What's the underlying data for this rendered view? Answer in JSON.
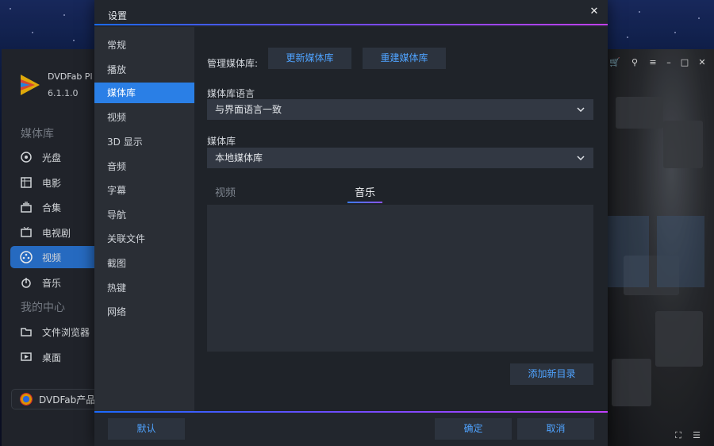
{
  "app": {
    "name": "DVDFab Pl",
    "version": "6.1.1.0",
    "section_media_library": "媒体库",
    "section_my_center": "我的中心",
    "sidebar_items": [
      {
        "label": "光盘",
        "icon": "disc-icon"
      },
      {
        "label": "电影",
        "icon": "film-icon"
      },
      {
        "label": "合集",
        "icon": "collection-icon"
      },
      {
        "label": "电视剧",
        "icon": "tv-icon"
      },
      {
        "label": "视频",
        "icon": "video-icon",
        "active": true
      },
      {
        "label": "音乐",
        "icon": "music-icon"
      },
      {
        "label": "文件浏览器",
        "icon": "folder-icon"
      },
      {
        "label": "桌面",
        "icon": "desktop-icon"
      }
    ],
    "products_label": "DVDFab产品"
  },
  "dialog": {
    "title": "设置",
    "close_icon": "close-icon",
    "nav_items": [
      {
        "label": "常规"
      },
      {
        "label": "播放"
      },
      {
        "label": "媒体库",
        "active": true
      },
      {
        "label": "视频"
      },
      {
        "label": "3D 显示"
      },
      {
        "label": "音频"
      },
      {
        "label": "字幕"
      },
      {
        "label": "导航"
      },
      {
        "label": "关联文件"
      },
      {
        "label": "截图"
      },
      {
        "label": "热键"
      },
      {
        "label": "网络"
      }
    ],
    "manage_label": "管理媒体库:",
    "update_button": "更新媒体库",
    "rebuild_button": "重建媒体库",
    "language_label": "媒体库语言",
    "language_value": "与界面语言一致",
    "library_label": "媒体库",
    "library_value": "本地媒体库",
    "tabs": [
      {
        "label": "视频",
        "active": false
      },
      {
        "label": "音乐",
        "active": true
      }
    ],
    "add_button": "添加新目录",
    "default_button": "默认",
    "ok_button": "确定",
    "cancel_button": "取消"
  },
  "colors": {
    "accent": "#2a7fe6",
    "link_text": "#4fa3ff",
    "dialog_bg": "#23272e"
  }
}
